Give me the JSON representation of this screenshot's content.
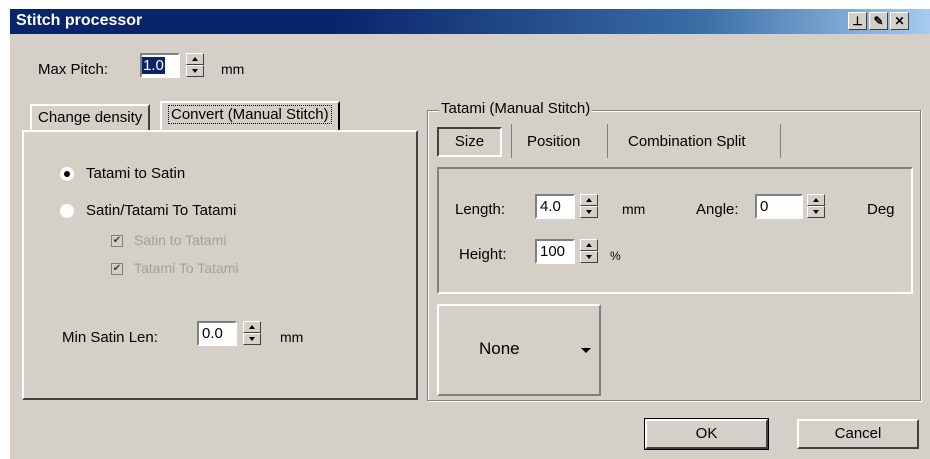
{
  "window": {
    "title": "Stitch processor"
  },
  "title_buttons": [
    "pin-icon",
    "edit-icon",
    "close-icon"
  ],
  "max_pitch": {
    "label": "Max Pitch:",
    "value": "1.0",
    "unit": "mm"
  },
  "left_tabs": {
    "tabs": [
      "Change density",
      "Convert (Manual Stitch)"
    ],
    "active": "Convert (Manual Stitch)"
  },
  "convert": {
    "radio_tatami_to_satin": "Tatami to Satin",
    "radio_satin_tatami": "Satin/Tatami To Tatami",
    "check_satin_to_tatami": "Satin to Tatami",
    "check_tatami_to_tatami": "Tatami To Tatami",
    "min_satin_len_label": "Min Satin Len:",
    "min_satin_len_value": "0.0",
    "min_satin_len_unit": "mm"
  },
  "tatami_group": {
    "label": "Tatami (Manual Stitch)",
    "tabs": [
      "Size",
      "Position",
      "Combination Split"
    ],
    "active_tab": "Size",
    "length_label": "Length:",
    "length_value": "4.0",
    "length_unit": "mm",
    "angle_label": "Angle:",
    "angle_value": "0",
    "angle_unit": "Deg",
    "height_label": "Height:",
    "height_value": "100",
    "height_unit": "%"
  },
  "pattern_dropdown": {
    "value": "None"
  },
  "buttons": {
    "ok": "OK",
    "cancel": "Cancel"
  }
}
